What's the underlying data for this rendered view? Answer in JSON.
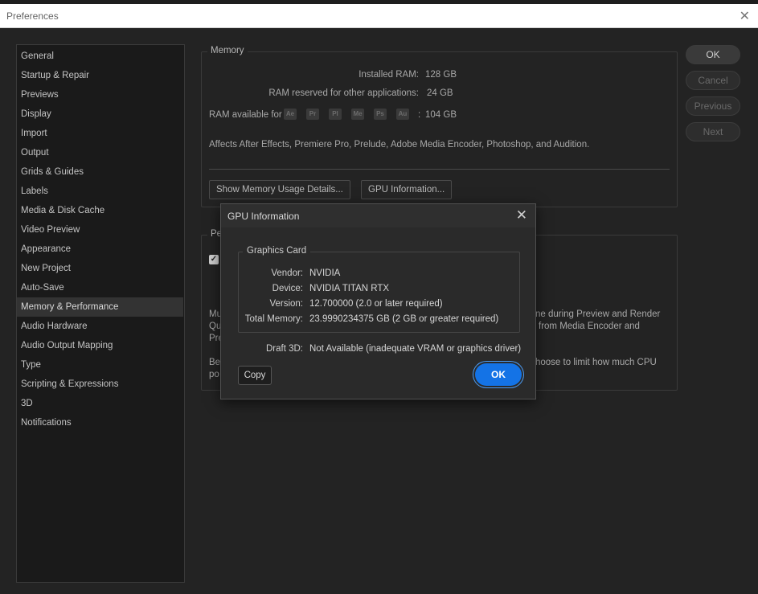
{
  "window": {
    "title": "Preferences"
  },
  "sidebar": {
    "items": [
      "General",
      "Startup & Repair",
      "Previews",
      "Display",
      "Import",
      "Output",
      "Grids & Guides",
      "Labels",
      "Media & Disk Cache",
      "Video Preview",
      "Appearance",
      "New Project",
      "Auto-Save",
      "Memory & Performance",
      "Audio Hardware",
      "Audio Output Mapping",
      "Type",
      "Scripting & Expressions",
      "3D",
      "Notifications"
    ],
    "selected": "Memory & Performance"
  },
  "buttons": {
    "ok": "OK",
    "cancel": "Cancel",
    "previous": "Previous",
    "next": "Next"
  },
  "memory": {
    "legend": "Memory",
    "installed_label": "Installed RAM:",
    "installed_value": "128 GB",
    "reserved_label": "RAM reserved for other applications:",
    "reserved_value": "24 GB",
    "available_label": "RAM available for",
    "app_icons": [
      "Ae",
      "Pr",
      "Pl",
      "Me",
      "Ps",
      "Au"
    ],
    "available_colon": ":",
    "available_value": "104 GB",
    "affects_note": "Affects After Effects, Premiere Pro, Prelude, Adobe Media Encoder, Photoshop, and Audition.",
    "show_usage_btn": "Show Memory Usage Details...",
    "gpu_info_btn": "GPU Information..."
  },
  "performance": {
    "legend_partial": "Pe",
    "partial_lines": {
      "l1_left": "Mu",
      "l2_left": "Qu",
      "l3_left": "Pre",
      "l4_left": "Be",
      "l5_left": "po",
      "r1": "ne during Preview and Render",
      "r2": "from Media Encoder and",
      "r3": "hoose to limit how much CPU"
    }
  },
  "gpu_dialog": {
    "title": "GPU Information",
    "group_title": "Graphics Card",
    "rows": [
      {
        "key": "Vendor:",
        "value": "NVIDIA"
      },
      {
        "key": "Device:",
        "value": "NVIDIA TITAN RTX"
      },
      {
        "key": "Version:",
        "value": "12.700000 (2.0 or later required)"
      },
      {
        "key": "Total Memory:",
        "value": "23.9990234375 GB (2 GB or greater required)"
      }
    ],
    "draft_key": "Draft 3D:",
    "draft_value": "Not Available (inadequate VRAM or graphics driver)",
    "copy_label": "Copy",
    "ok_label": "OK"
  }
}
